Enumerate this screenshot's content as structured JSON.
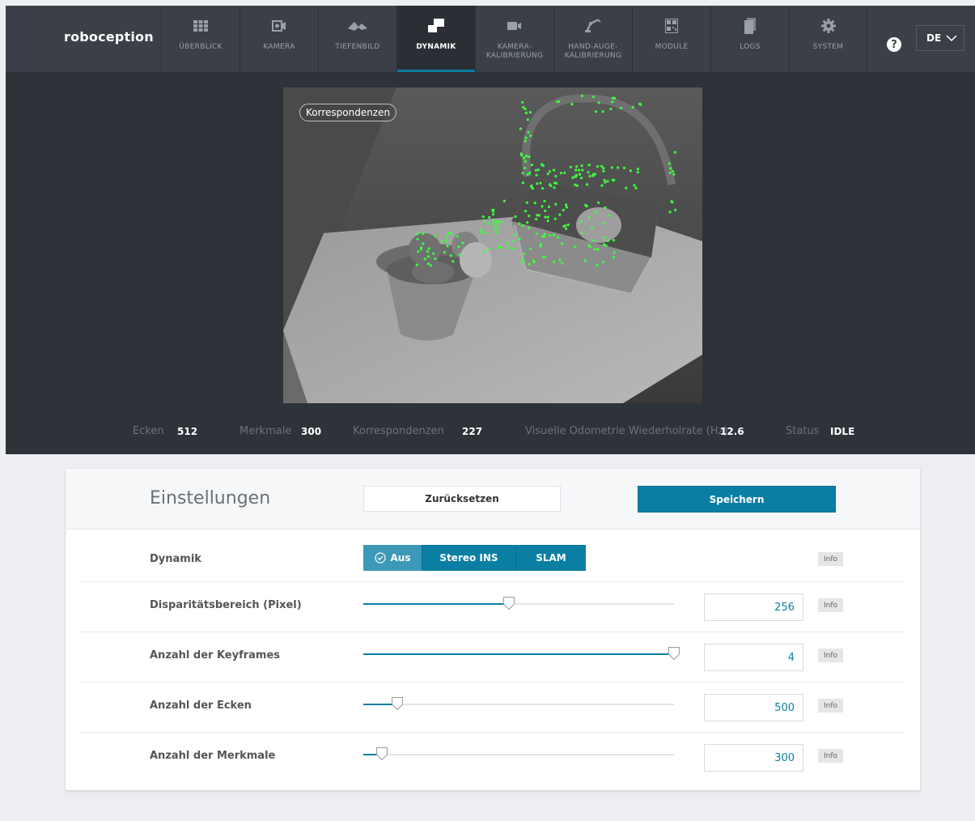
{
  "app": {
    "brand": "roboception"
  },
  "nav": [
    {
      "label": "ÜBERBLICK",
      "icon": "grid-icon"
    },
    {
      "label": "KAMERA",
      "icon": "camera-icon"
    },
    {
      "label": "TIEFENBILD",
      "icon": "depth-icon"
    },
    {
      "label": "DYNAMIK",
      "icon": "dynamics-icon",
      "active": true
    },
    {
      "label": "KAMERA-\nKALIBRIERUNG",
      "icon": "video-camera-icon"
    },
    {
      "label": "HAND-AUGE-\nKALIBRIERUNG",
      "icon": "robot-arm-icon"
    },
    {
      "label": "MODULE",
      "icon": "qr-module-icon"
    },
    {
      "label": "LOGS",
      "icon": "document-icon"
    },
    {
      "label": "SYSTEM",
      "icon": "gear-icon"
    }
  ],
  "header": {
    "language": "DE"
  },
  "viewer": {
    "overlay_label": "Korrespondenzen"
  },
  "stats": [
    {
      "label": "Ecken",
      "value": "512"
    },
    {
      "label": "Merkmale",
      "value": "300"
    },
    {
      "label": "Korrespondenzen",
      "value": "227"
    },
    {
      "label": "Visuelle Odometrie Wiederholrate (Hz)",
      "value": "12.6"
    },
    {
      "label": "Status",
      "value": "IDLE"
    }
  ],
  "settings": {
    "title": "Einstellungen",
    "reset_label": "Zurücksetzen",
    "save_label": "Speichern",
    "info_label": "Info",
    "dynamics": {
      "label": "Dynamik",
      "options": [
        "Aus",
        "Stereo INS",
        "SLAM"
      ],
      "selected": "Aus"
    },
    "sliders": [
      {
        "label": "Disparitätsbereich (Pixel)",
        "value": "256",
        "fraction": 0.47
      },
      {
        "label": "Anzahl der Keyframes",
        "value": "4",
        "fraction": 1.0
      },
      {
        "label": "Anzahl der Ecken",
        "value": "500",
        "fraction": 0.11
      },
      {
        "label": "Anzahl der Merkmale",
        "value": "300",
        "fraction": 0.06
      }
    ]
  },
  "colors": {
    "accent": "#0b7fa3",
    "topbar": "#3b4048",
    "feature_points": "#3cff3c"
  }
}
